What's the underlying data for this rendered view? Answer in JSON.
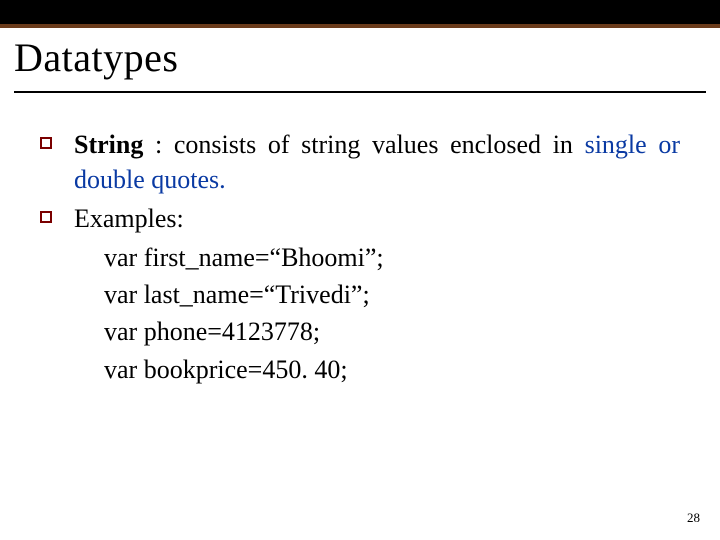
{
  "title": "Datatypes",
  "bullets": [
    {
      "label": "String",
      "sep": " : ",
      "rest1": "consists of string values enclosed in ",
      "rest2_blue": "single or double quotes.",
      "lines": []
    },
    {
      "label": "Examples:",
      "lines": [
        "var first_name=“Bhoomi”;",
        "var last_name=“Trivedi”;",
        "var phone=4123778;",
        "var bookprice=450. 40;"
      ]
    }
  ],
  "page_number": "28"
}
